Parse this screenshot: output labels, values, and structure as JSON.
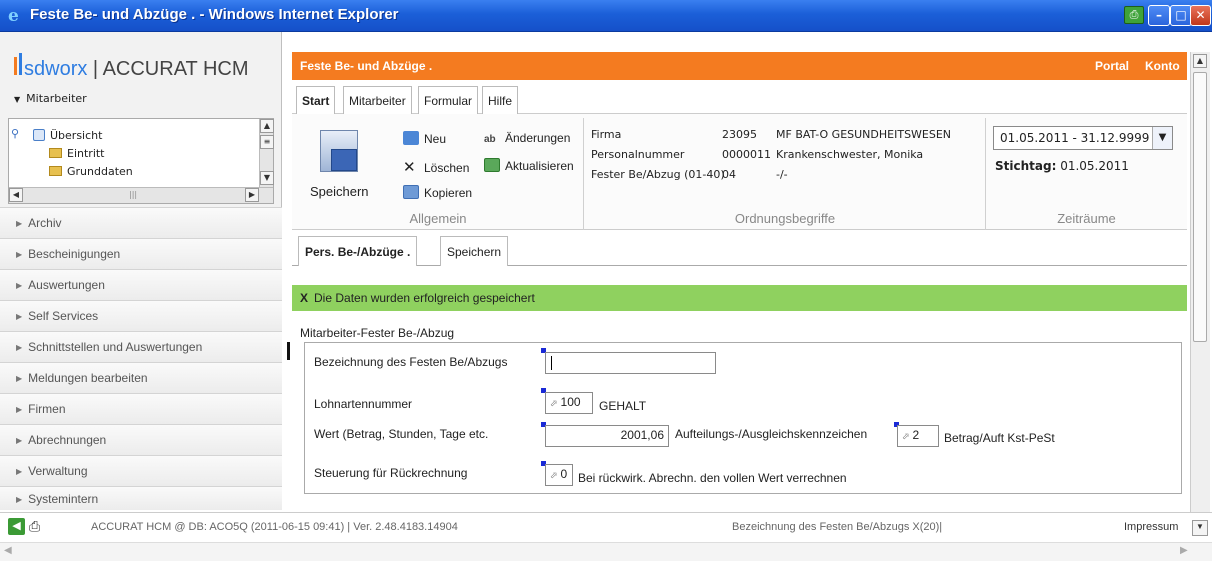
{
  "window": {
    "title": "Feste Be- und Abzüge . - Windows Internet Explorer"
  },
  "brand": {
    "company": "sdworx",
    "product": "ACCURAT HCM",
    "separator": "|"
  },
  "sidebar": {
    "section_label": "Mitarbeiter",
    "tree": [
      {
        "label": "Übersicht",
        "icon": "grid-icon"
      },
      {
        "label": "Eintritt",
        "icon": "folder-icon"
      },
      {
        "label": "Grunddaten",
        "icon": "folder-icon"
      }
    ],
    "nav": [
      "Archiv",
      "Bescheinigungen",
      "Auswertungen",
      "Self Services",
      "Schnittstellen und Auswertungen",
      "Meldungen bearbeiten",
      "Firmen",
      "Abrechnungen",
      "Verwaltung",
      "Systemintern"
    ]
  },
  "header": {
    "title": "Feste Be- und Abzüge .",
    "links": [
      "Portal",
      "Konto"
    ]
  },
  "menu_tabs": [
    "Start",
    "Mitarbeiter",
    "Formular",
    "Hilfe"
  ],
  "ribbon": {
    "allgemein": {
      "label": "Allgemein",
      "save": "Speichern",
      "new": "Neu",
      "delete": "Löschen",
      "copy": "Kopieren",
      "changes": "Änderungen",
      "refresh": "Aktualisieren"
    },
    "ordnung": {
      "label": "Ordnungsbegriffe",
      "rows": [
        {
          "key": "Firma",
          "code": "23095",
          "value": "MF BAT-O GESUNDHEITSWESEN"
        },
        {
          "key": "Personalnummer",
          "code": "0000011",
          "value": "Krankenschwester, Monika"
        },
        {
          "key": "Fester Be/Abzug (01-40)",
          "code": "04",
          "value": "-/-"
        }
      ]
    },
    "zeitraeume": {
      "label": "Zeiträume",
      "range": "01.05.2011 - 31.12.9999",
      "stichtag_label": "Stichtag:",
      "stichtag_value": "01.05.2011"
    }
  },
  "sub_tabs": [
    "Pers. Be-/Abzüge .",
    "Speichern"
  ],
  "message": {
    "icon": "X",
    "text": "Die Daten wurden erfolgreich gespeichert"
  },
  "form": {
    "section": "Mitarbeiter-Fester Be-/Abzug",
    "bezeichnung_label": "Bezeichnung des Festen Be/Abzugs",
    "bezeichnung_value": "",
    "lohnart_label": "Lohnartennummer",
    "lohnart_value": "100",
    "lohnart_text": "GEHALT",
    "wert_label": "Wert (Betrag, Stunden, Tage etc.",
    "wert_value": "2001,06",
    "aufteilung_label": "Aufteilungs-/Ausgleichskennzeichen",
    "aufteilung_value": "2",
    "aufteilung_text": "Betrag/Auft Kst-PeSt",
    "steuerung_label": "Steuerung für Rückrechnung",
    "steuerung_value": "0",
    "steuerung_text": "Bei rückwirk. Abrechn. den vollen Wert verrechnen"
  },
  "status": {
    "left": "ACCURAT HCM @ DB: ACO5Q (2011-06-15 09:41) | Ver. 2.48.4183.14904",
    "middle": "Bezeichnung des Festen Be/Abzugs X(20)|",
    "right": "Impressum"
  },
  "colors": {
    "orange": "#f47b20",
    "success": "#8fd15f",
    "titlebar": "#1b5fd8"
  }
}
